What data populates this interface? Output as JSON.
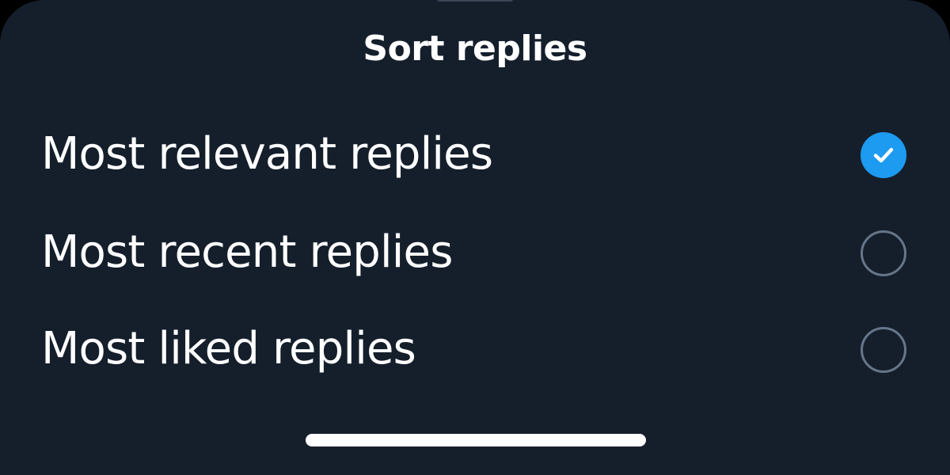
{
  "sheet": {
    "title": "Sort replies",
    "options": [
      {
        "label": "Most relevant replies",
        "selected": true
      },
      {
        "label": "Most recent replies",
        "selected": false
      },
      {
        "label": "Most liked replies",
        "selected": false
      }
    ]
  },
  "icons": {
    "selected": "check-circle-icon",
    "unselected": "empty-radio-icon"
  },
  "colors": {
    "background": "#151f2c",
    "accent": "#1d9bf0",
    "radio_border": "#66768a",
    "text": "#ffffff"
  }
}
